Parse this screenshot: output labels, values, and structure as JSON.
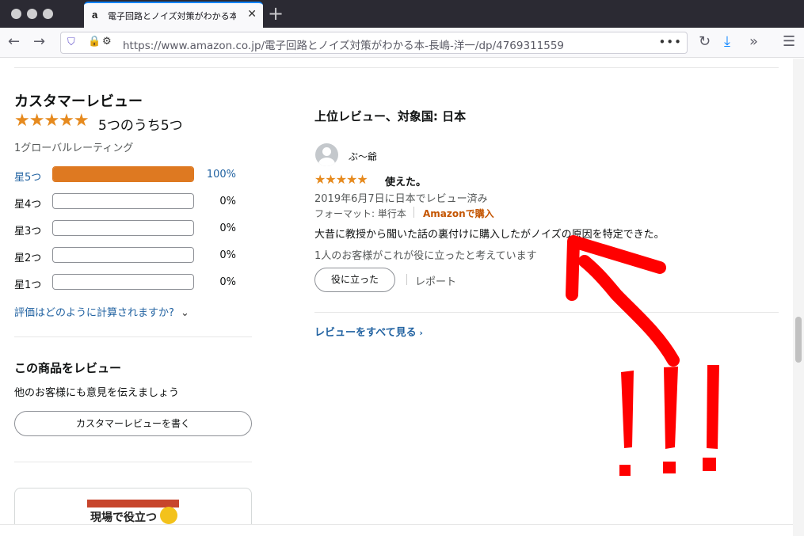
{
  "browser": {
    "tab_title": "電子回路とノイズ対策がわかる本",
    "tab_favicon": "a",
    "url": "https://www.amazon.co.jp/電子回路とノイズ対策がわかる本-長嶋-洋一/dp/4769311559"
  },
  "sidebar": {
    "heading": "カスタマーレビュー",
    "overall_rating_text": "5つのうち5つ",
    "global_ratings": "1グローバルレーティング",
    "histogram": [
      {
        "label": "星5つ",
        "pct": "100%",
        "fill": 1.0,
        "highlight": true
      },
      {
        "label": "星4つ",
        "pct": "0%",
        "fill": 0.0,
        "highlight": false
      },
      {
        "label": "星3つ",
        "pct": "0%",
        "fill": 0.0,
        "highlight": false
      },
      {
        "label": "星2つ",
        "pct": "0%",
        "fill": 0.0,
        "highlight": false
      },
      {
        "label": "星1つ",
        "pct": "0%",
        "fill": 0.0,
        "highlight": false
      }
    ],
    "how_calculated": "評価はどのように計算されますか?",
    "review_product_heading": "この商品をレビュー",
    "review_product_sub": "他のお客様にも意見を伝えましょう",
    "write_review_button": "カスタマーレビューを書く",
    "book_cover_title": "現場で役立つ"
  },
  "reviews": {
    "heading": "上位レビュー、対象国: 日本",
    "items": [
      {
        "author": "ぶ〜爺",
        "stars": 5,
        "title": "使えた。",
        "date": "2019年6月7日に日本でレビュー済み",
        "format": "フォーマット: 単行本",
        "badge": "Amazonで購入",
        "body": "大昔に教授から聞いた話の裏付けに購入したがノイズの原因を特定できた。",
        "helpful_count": "1人のお客様がこれが役に立ったと考えています",
        "helpful_button": "役に立った",
        "report_link": "レポート"
      }
    ],
    "see_all": "レビューをすべて見る"
  },
  "colors": {
    "star": "#e68a1e",
    "histogram_fill": "#de7921",
    "link": "#2162a1",
    "badge": "#c45500",
    "annotation": "#ff0000"
  }
}
